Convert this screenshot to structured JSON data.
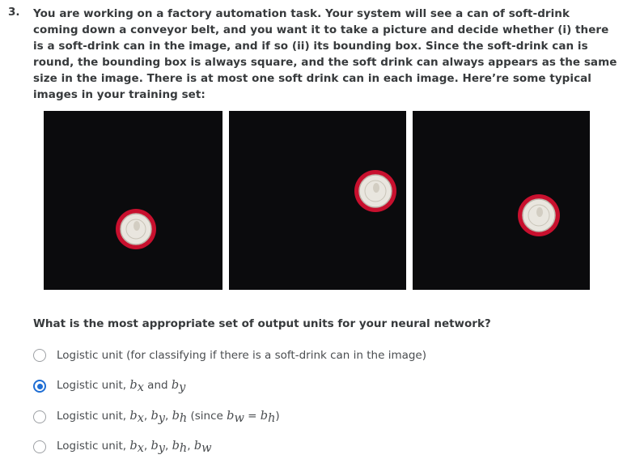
{
  "question": {
    "number": "3.",
    "text": "You are working on a factory automation task. Your system will see a can of soft-drink coming down a conveyor belt, and you want it to take a picture and decide whether (i) there is a soft-drink can in the image, and if so (ii) its bounding box. Since the soft-drink can is round, the bounding box is always square, and the soft drink can always appears as the same size in the image. There is at most one soft drink can in each image. Here’re some typical images in your training set:",
    "prompt": "What is the most appropriate set of output units for your neural network?"
  },
  "images": [
    {
      "name": "training-image-1",
      "can": "top-down red soft-drink can"
    },
    {
      "name": "training-image-2",
      "can": "top-down red soft-drink can"
    },
    {
      "name": "training-image-3",
      "can": "top-down red soft-drink can"
    }
  ],
  "options": [
    {
      "selected": false,
      "prefix": "Logistic unit (for classifying if there is a soft-drink can in the image)"
    },
    {
      "selected": true,
      "prefix": "Logistic unit, ",
      "b": "b",
      "x": "x",
      "and": " and ",
      "y": "y"
    },
    {
      "selected": false,
      "prefix": "Logistic unit, ",
      "b": "b",
      "x": "x",
      "y": "y",
      "h": "h",
      "w": "w",
      "comma": ", ",
      "since": " (since ",
      "eq": " = ",
      "close": ")"
    },
    {
      "selected": false,
      "prefix": "Logistic unit, ",
      "b": "b",
      "x": "x",
      "y": "y",
      "h": "h",
      "w": "w",
      "comma": ", "
    }
  ],
  "colors": {
    "accent": "#1f6ed4",
    "photo_bg": "#0b0b0d",
    "can_red": "#c8102e"
  }
}
